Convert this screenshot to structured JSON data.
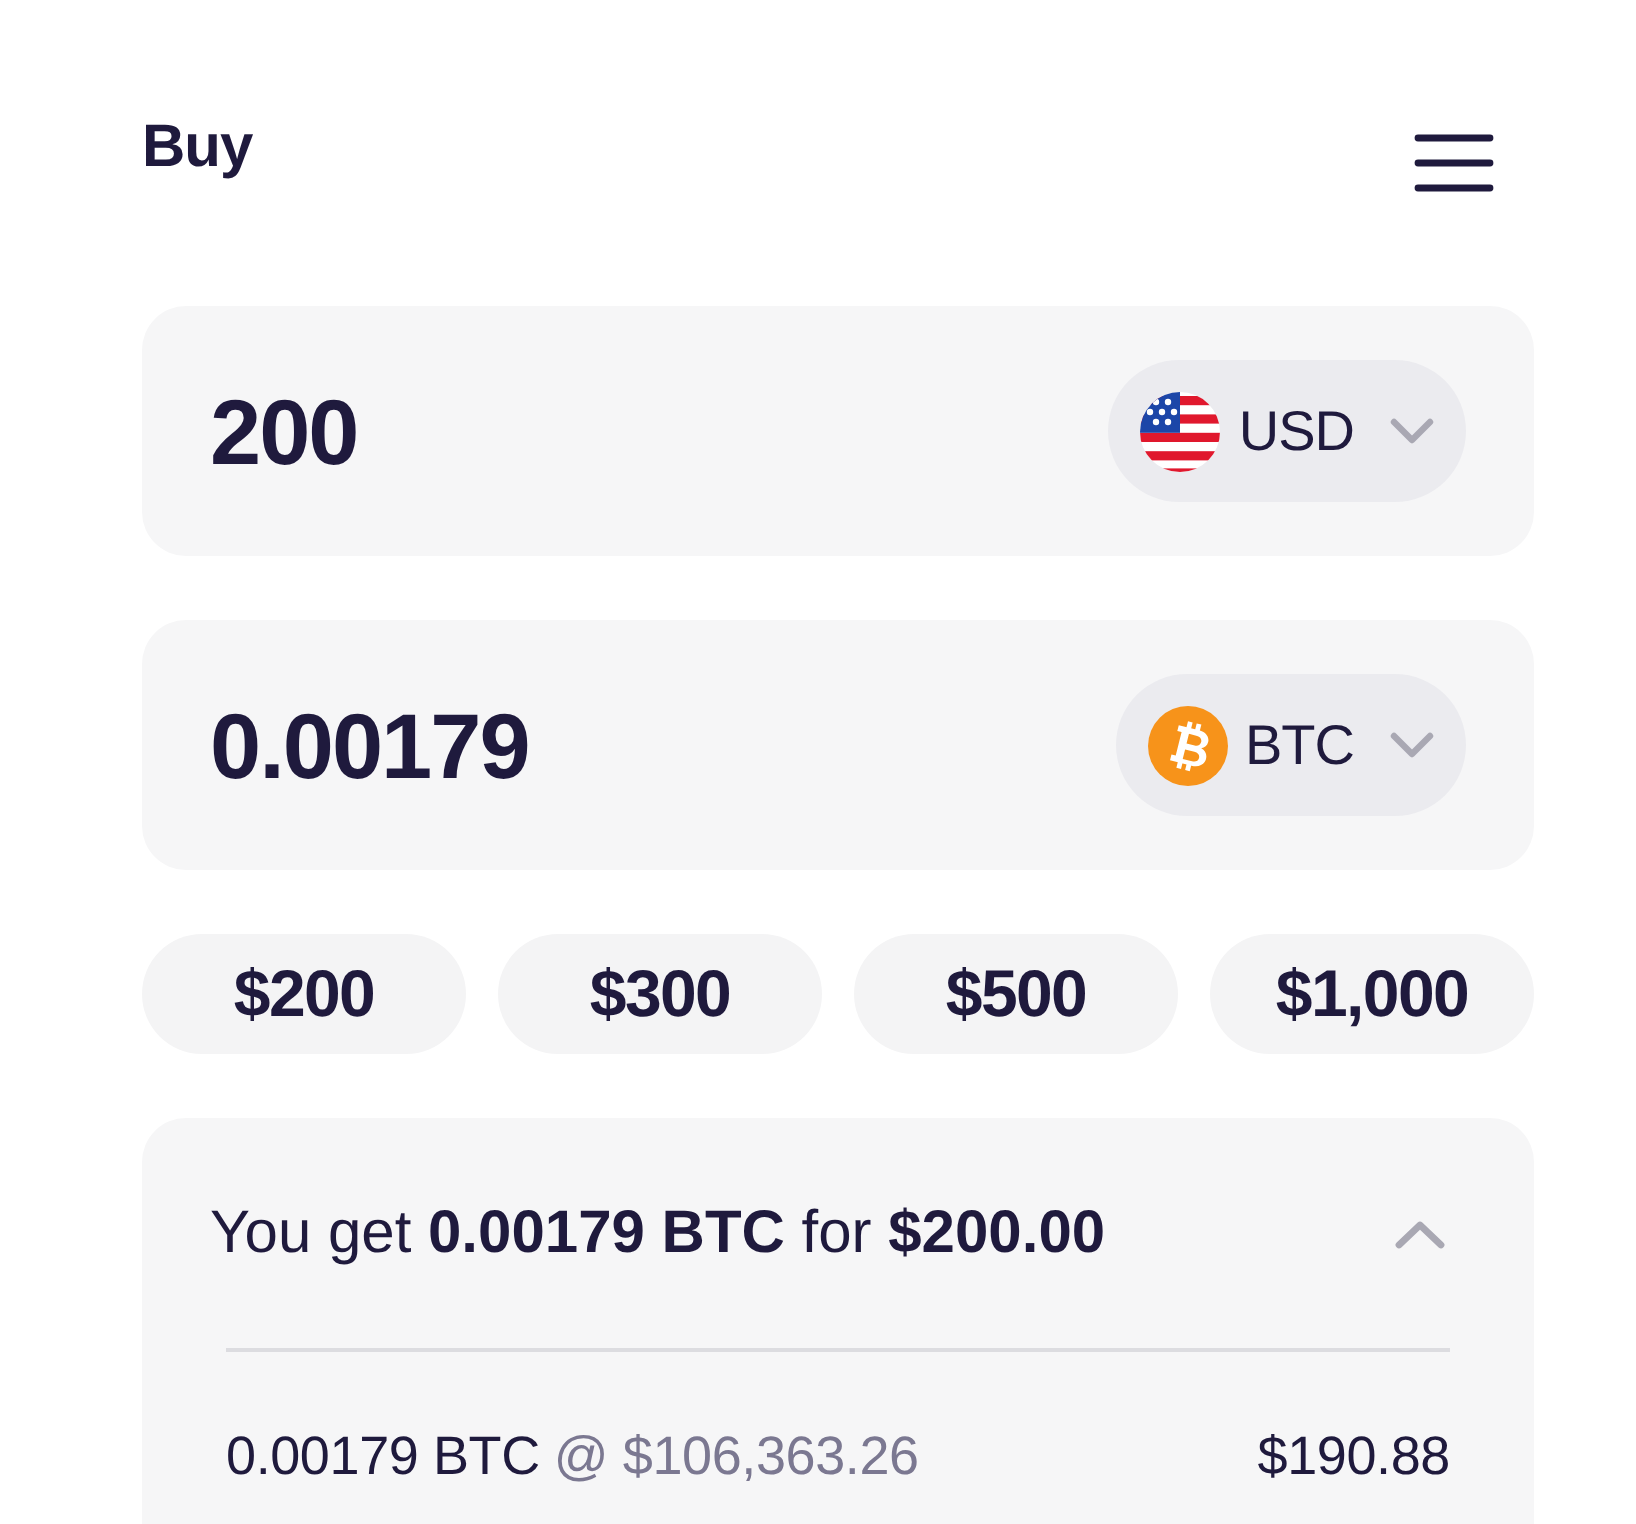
{
  "header": {
    "title": "Buy"
  },
  "amounts": [
    {
      "value": "200",
      "currency": {
        "code": "USD",
        "kind": "flag"
      }
    },
    {
      "value": "0.00179",
      "currency": {
        "code": "BTC",
        "kind": "coin"
      }
    }
  ],
  "quick_amounts": [
    "$200",
    "$300",
    "$500",
    "$1,000"
  ],
  "summary": {
    "headline": "You get **0.00179 BTC** for **$200.00**",
    "expanded": true,
    "rows": [
      {
        "amount": "0.00179 BTC",
        "rate": "@ $106,363.26",
        "value": "$190.88"
      }
    ]
  }
}
